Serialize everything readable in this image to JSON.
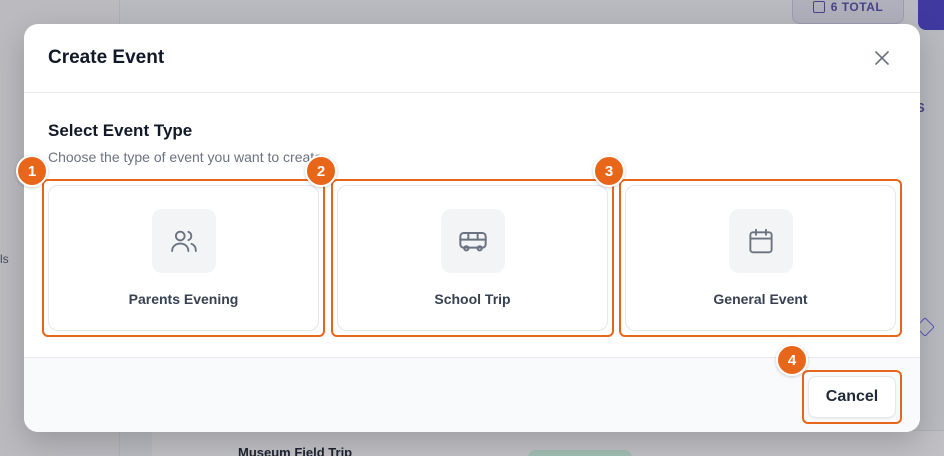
{
  "background": {
    "total_badge": "6 TOTAL",
    "sidebar_fragment": "ls",
    "row_title": "Museum Field Trip",
    "filter_fragment": "S"
  },
  "modal": {
    "title": "Create Event",
    "section_title": "Select Event Type",
    "section_subtitle": "Choose the type of event you want to create",
    "event_types": [
      {
        "label": "Parents Evening",
        "icon": "users-icon",
        "marker": "1"
      },
      {
        "label": "School Trip",
        "icon": "bus-icon",
        "marker": "2"
      },
      {
        "label": "General Event",
        "icon": "calendar-icon",
        "marker": "3"
      }
    ],
    "cancel_label": "Cancel",
    "cancel_marker": "4"
  },
  "colors": {
    "accent_marker": "#e8661a",
    "primary": "#4338ca"
  }
}
